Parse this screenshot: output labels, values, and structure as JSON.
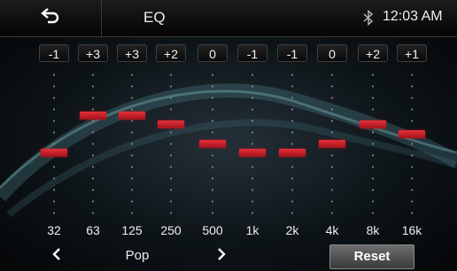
{
  "header": {
    "title": "EQ",
    "time": "12:03 AM",
    "back_icon": "back-arrow-icon",
    "bluetooth_icon": "bluetooth-icon"
  },
  "eq": {
    "range": [
      -7,
      7
    ],
    "bands": [
      {
        "freq": "32",
        "label": "-1",
        "value": -1
      },
      {
        "freq": "63",
        "label": "+3",
        "value": 3
      },
      {
        "freq": "125",
        "label": "+3",
        "value": 3
      },
      {
        "freq": "250",
        "label": "+2",
        "value": 2
      },
      {
        "freq": "500",
        "label": "0",
        "value": 0
      },
      {
        "freq": "1k",
        "label": "-1",
        "value": -1
      },
      {
        "freq": "2k",
        "label": "-1",
        "value": -1
      },
      {
        "freq": "4k",
        "label": "0",
        "value": 0
      },
      {
        "freq": "8k",
        "label": "+2",
        "value": 2
      },
      {
        "freq": "16k",
        "label": "+1",
        "value": 1
      }
    ],
    "thumb_color": "#d0202a"
  },
  "footer": {
    "preset": "Pop",
    "reset_label": "Reset",
    "prev_icon": "chevron-left-icon",
    "next_icon": "chevron-right-icon"
  }
}
